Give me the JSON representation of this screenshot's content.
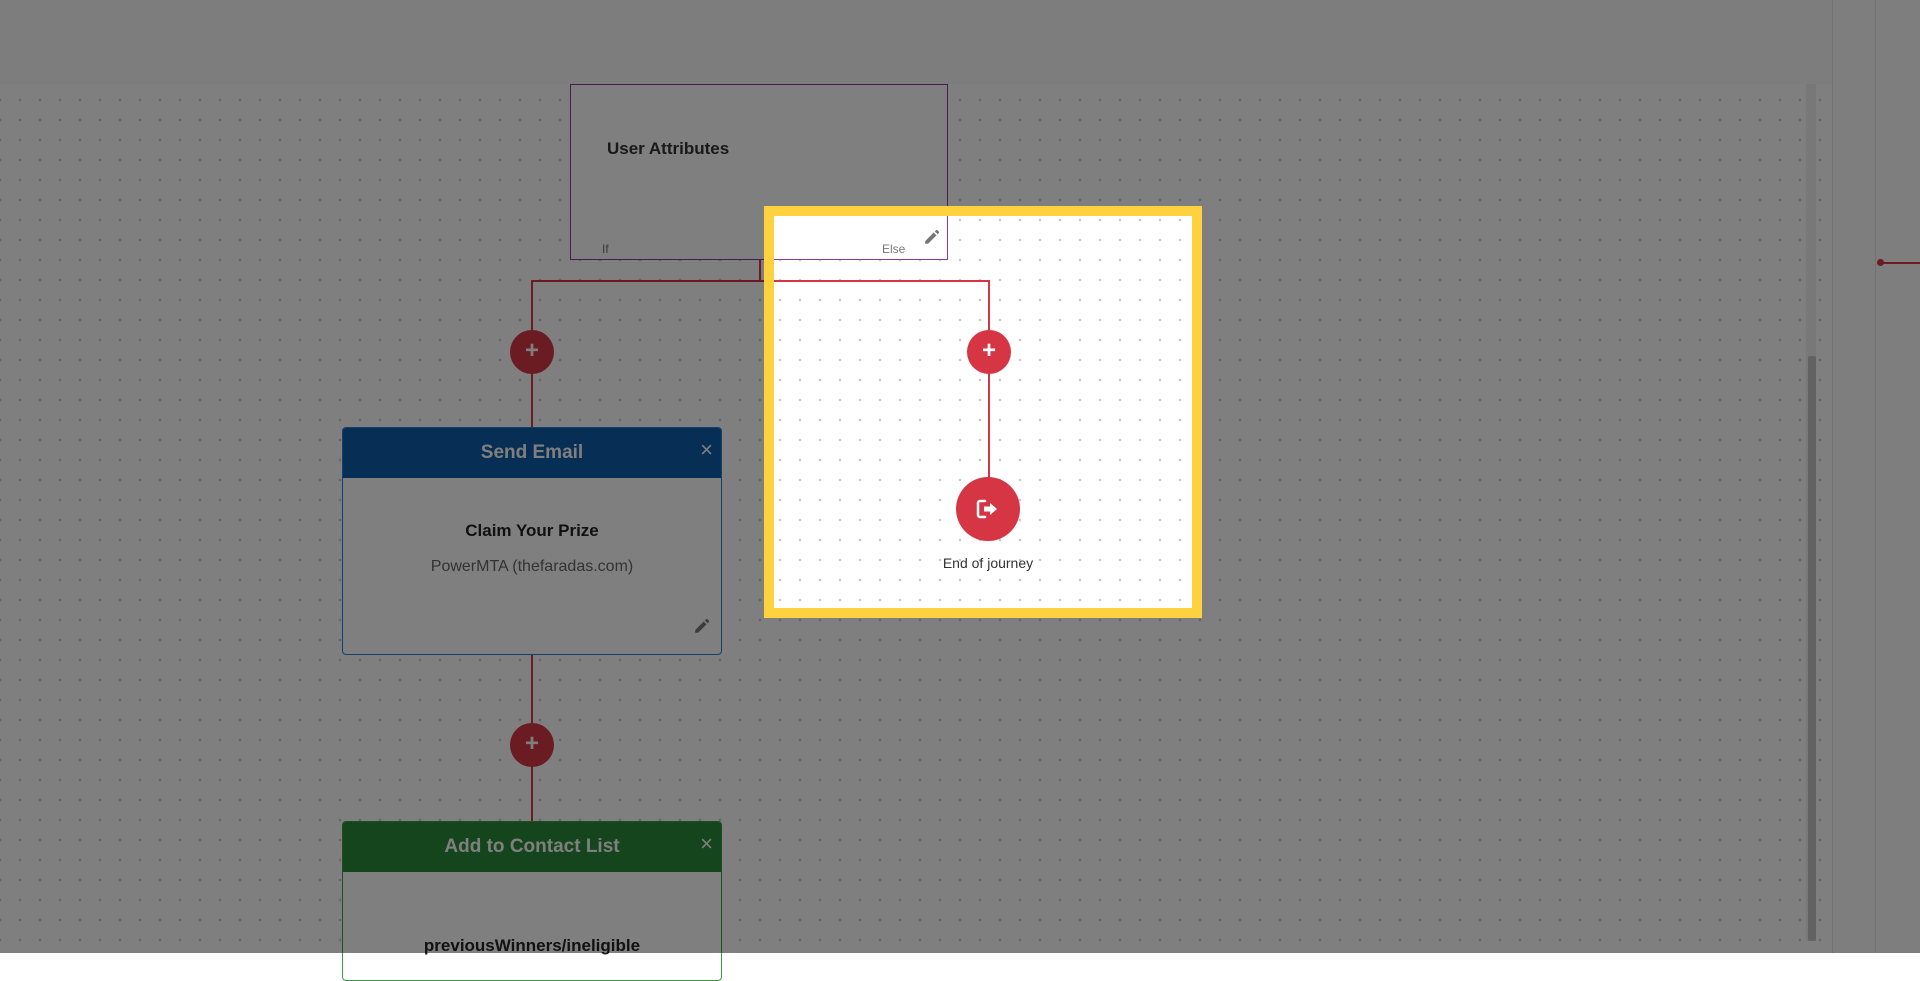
{
  "condition_node": {
    "title": "User Attributes",
    "if_label": "If",
    "else_label": "Else",
    "edit_icon": "pencil-icon"
  },
  "plus_icon": "+",
  "send_email_node": {
    "title": "Send Email",
    "close_label": "×",
    "subject": "Claim Your Prize",
    "sender": "PowerMTA (thefaradas.com)",
    "edit_icon": "pencil-icon"
  },
  "contact_list_node": {
    "title": "Add to Contact List",
    "close_label": "×",
    "list_name": "previousWinners/ineligible"
  },
  "end_node": {
    "label": "End of journey",
    "icon": "exit-icon"
  },
  "colors": {
    "connector": "#d63644",
    "email_header": "#0e5ca8",
    "list_header": "#2b8a3a",
    "condition_border": "#8a3aa8",
    "highlight": "#fdd23e"
  }
}
